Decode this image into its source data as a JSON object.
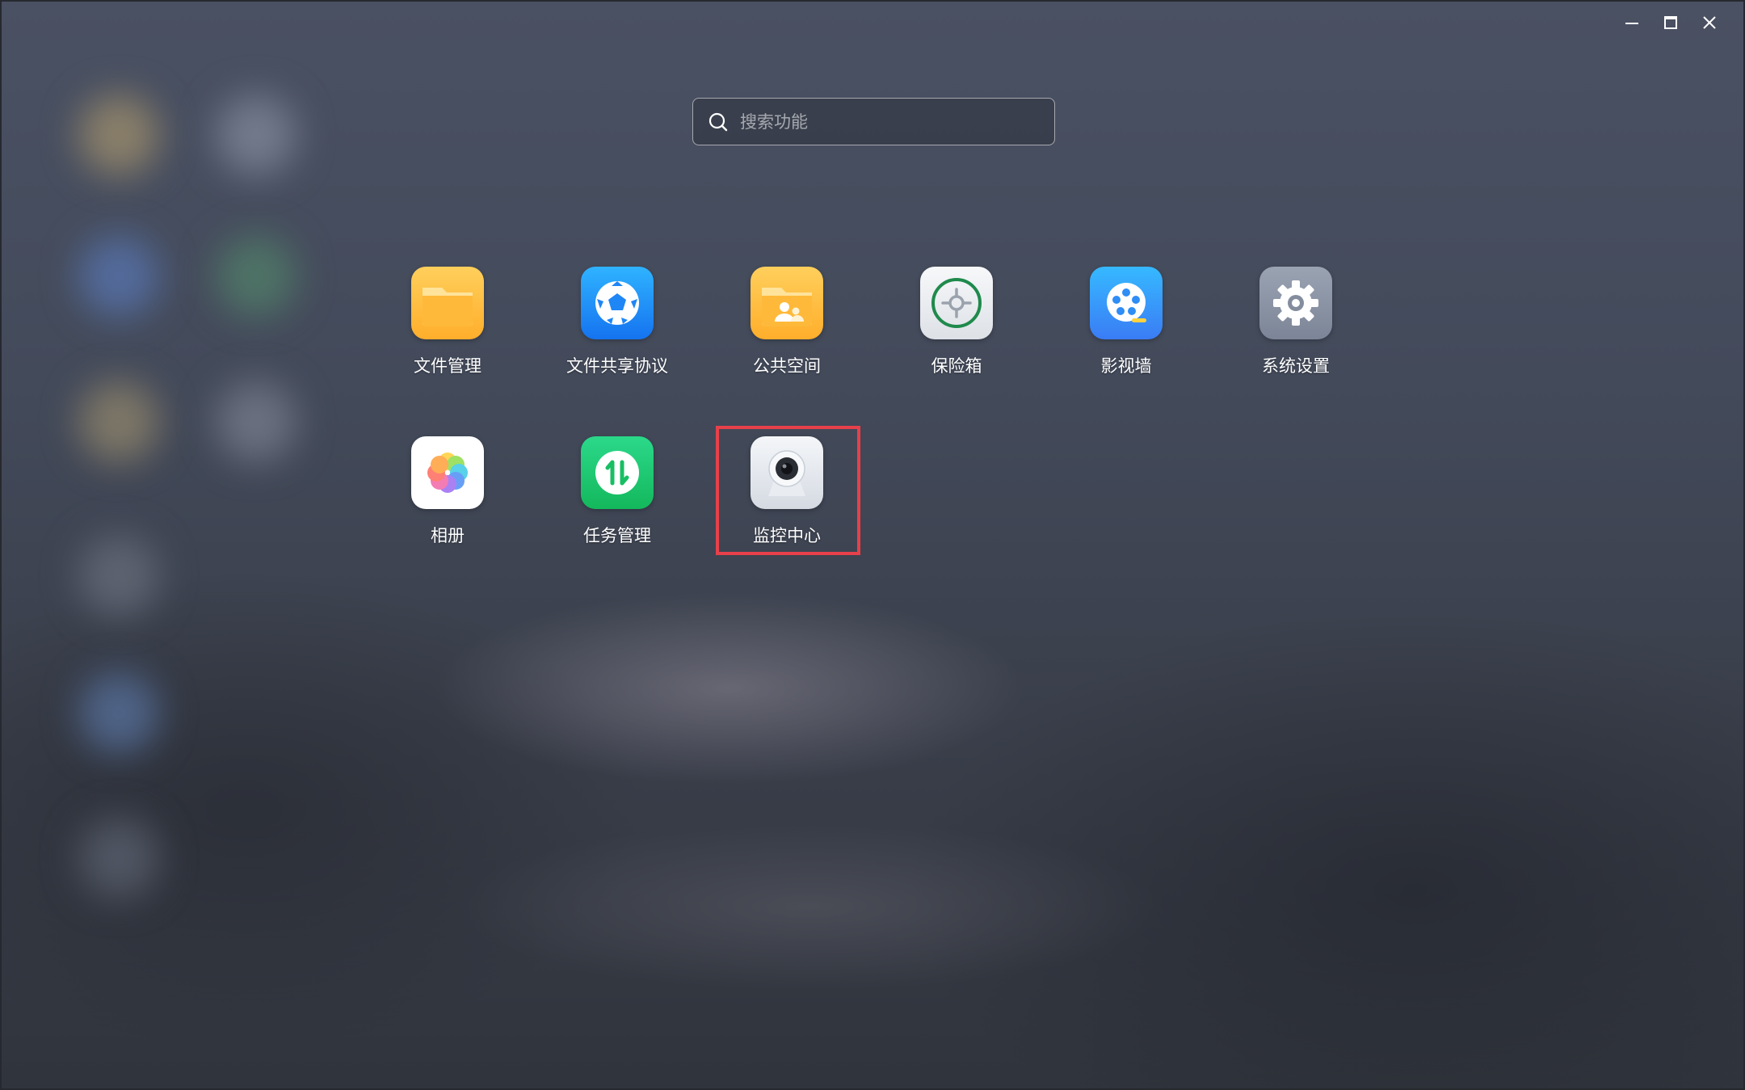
{
  "window": {
    "controls": {
      "minimize": "minimize-icon",
      "maximize": "maximize-icon",
      "close": "close-icon"
    }
  },
  "search": {
    "placeholder": "搜索功能",
    "value": "",
    "icon": "search-icon"
  },
  "apps": [
    {
      "label": "文件管理",
      "icon": "folder-icon"
    },
    {
      "label": "文件共享协议",
      "icon": "share-protocol-icon"
    },
    {
      "label": "公共空间",
      "icon": "shared-folder-icon"
    },
    {
      "label": "保险箱",
      "icon": "safe-icon"
    },
    {
      "label": "影视墙",
      "icon": "film-reel-icon"
    },
    {
      "label": "系统设置",
      "icon": "gear-icon"
    },
    {
      "label": "相册",
      "icon": "photos-flower-icon"
    },
    {
      "label": "任务管理",
      "icon": "transfer-arrows-icon"
    },
    {
      "label": "监控中心",
      "icon": "camera-icon"
    }
  ],
  "colors": {
    "highlight": "#e8404a",
    "folder": "#ffb733",
    "share": "#1e90ff",
    "task": "#1fcb6c",
    "settings": "#8a93a3"
  }
}
